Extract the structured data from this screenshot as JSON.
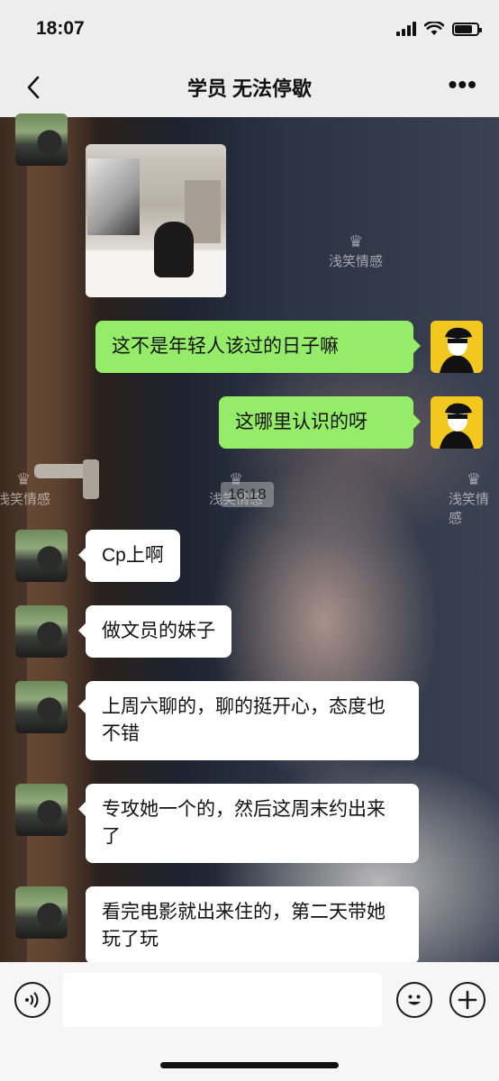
{
  "status_bar": {
    "time": "18:07"
  },
  "nav": {
    "title": "学员 无法停歇",
    "more_label": "•••"
  },
  "watermark": {
    "text": "浅笑情感"
  },
  "messages": [
    {
      "type": "image",
      "direction": "in",
      "description_icon": "photo-bedroom-projector"
    },
    {
      "type": "text",
      "direction": "out",
      "text": "这不是年轻人该过的日子嘛"
    },
    {
      "type": "text",
      "direction": "out",
      "text": "这哪里认识的呀"
    },
    {
      "type": "timestamp",
      "text": "16:18"
    },
    {
      "type": "text",
      "direction": "in",
      "text": "Cp上啊"
    },
    {
      "type": "text",
      "direction": "in",
      "text": "做文员的妹子"
    },
    {
      "type": "text",
      "direction": "in",
      "text": "上周六聊的，聊的挺开心，态度也不错"
    },
    {
      "type": "text",
      "direction": "in",
      "text": "专攻她一个的，然后这周末约出来了"
    },
    {
      "type": "text",
      "direction": "in",
      "text": "看完电影就出来住的，第二天带她玩了玩"
    }
  ],
  "input_bar": {
    "voice_icon": "voice-icon",
    "emoji_icon": "emoji-icon",
    "plus_icon": "plus-icon",
    "text_value": ""
  },
  "colors": {
    "outgoing_bubble": "#95ec69",
    "incoming_bubble": "#ffffff",
    "bar_background": "#ededed",
    "outgoing_avatar": "#f3c81e"
  }
}
